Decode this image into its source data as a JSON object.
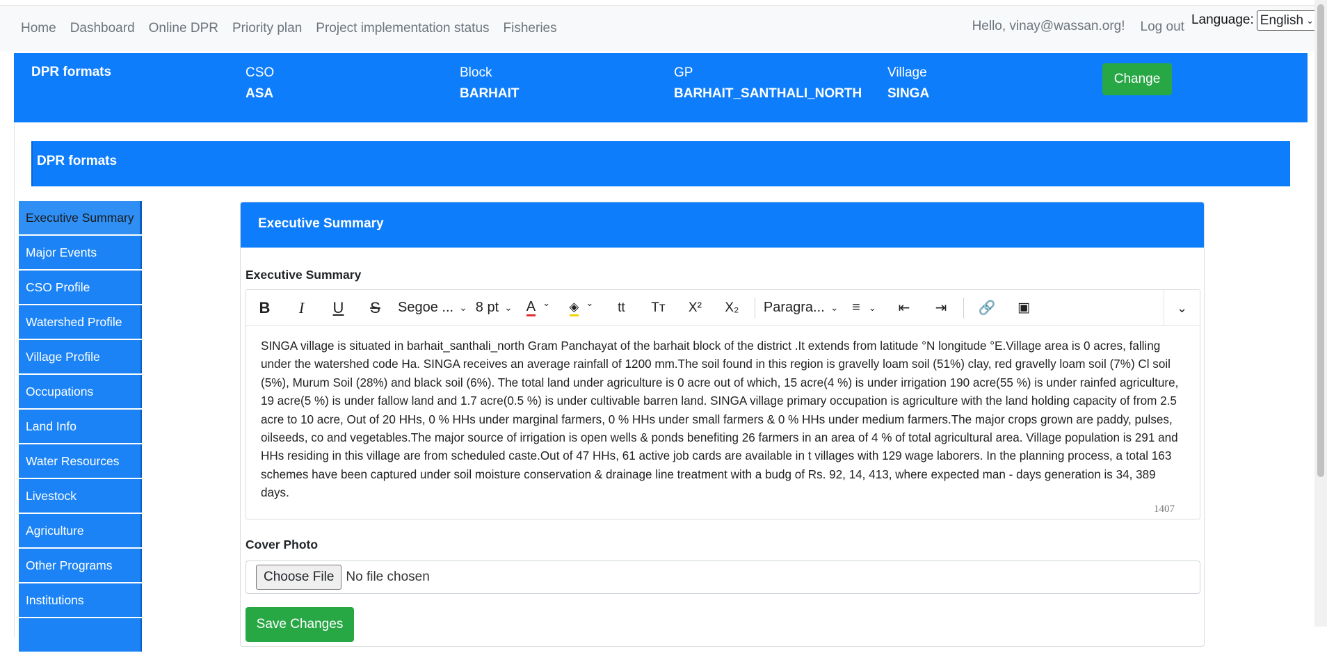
{
  "nav": {
    "links": [
      "Home",
      "Dashboard",
      "Online DPR",
      "Priority plan",
      "Project implementation status",
      "Fisheries"
    ],
    "hello": "Hello, vinay@wassan.org!",
    "logout": "Log out",
    "language_label": "Language:",
    "language_value": "English"
  },
  "header": {
    "title": "DPR formats",
    "cso_label": "CSO",
    "cso_value": "ASA",
    "block_label": "Block",
    "block_value": "BARHAIT",
    "gp_label": "GP",
    "gp_value": "BARHAIT_SANTHALI_NORTH",
    "village_label": "Village",
    "village_value": "SINGA",
    "change_label": "Change"
  },
  "section_title": "DPR formats",
  "sidebar": {
    "items": [
      "Executive Summary",
      "Major Events",
      "CSO Profile",
      "Watershed Profile",
      "Village Profile",
      "Occupations",
      "Land Info",
      "Water Resources",
      "Livestock",
      "Agriculture",
      "Other Programs",
      "Institutions",
      ""
    ],
    "active": "Executive Summary"
  },
  "panel": {
    "title": "Executive Summary",
    "field_label": "Executive Summary",
    "toolbar": {
      "font": "Segoe ...",
      "size": "8 pt",
      "block": "Paragra..."
    },
    "body": "SINGA village is situated in barhait_santhali_north Gram Panchayat of the barhait block of the district .It extends from latitude °N longitude °E.Village area is 0 acres, falling under the watershed code Ha. SINGA receives an average rainfall of 1200 mm.The soil found in this region is gravelly loam soil (51%) clay, red gravelly loam soil (7%) Cl soil (5%), Murum Soil (28%) and black soil (6%). The total land under agriculture is 0 acre out of which, 15 acre(4 %) is under irrigation 190 acre(55 %) is under rainfed agriculture, 19 acre(5 %) is under fallow land and 1.7 acre(0.5 %) is under cultivable barren land. SINGA village primary occupation is agriculture with the land holding capacity of from 2.5 acre to 10 acre, Out of 20 HHs, 0 % HHs under marginal farmers, 0 % HHs under small farmers & 0 % HHs under medium farmers.The major crops grown are paddy, pulses, oilseeds, co and vegetables.The major source of irrigation is open wells & ponds benefiting 26 farmers in an area of 4 % of total agricultural area. Village population is 291 and HHs residing in this village are from scheduled caste.Out of 47 HHs, 61 active job cards are available in t villages with 129 wage laborers. In the planning process, a total 163 schemes have been captured under soil moisture conservation & drainage line treatment with a budg of Rs. 92, 14, 413, where expected man - days generation is 34, 389 days.",
    "char_count": "1407",
    "cover_label": "Cover Photo",
    "choose_file": "Choose File",
    "no_file": "No file chosen",
    "save_label": "Save Changes"
  }
}
